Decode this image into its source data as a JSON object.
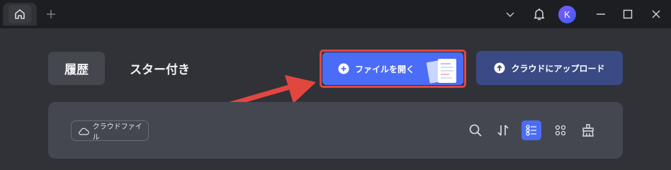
{
  "titlebar": {
    "icons": [
      "home-icon",
      "plus-icon",
      "chevron-down-icon",
      "bell-icon",
      "minimize-icon",
      "maximize-icon",
      "close-icon"
    ],
    "avatar_initial": "K"
  },
  "tabs": {
    "history_label": "履歴",
    "starred_label": "スター付き"
  },
  "actions": {
    "open_file_label": "ファイルを開く",
    "upload_cloud_label": "クラウドにアップロード"
  },
  "panel": {
    "cloud_file_label": "クラウドファイル",
    "tool_icons": [
      "search-icon",
      "sort-icon",
      "list-view-icon",
      "grid-view-icon",
      "clean-icon"
    ]
  },
  "colors": {
    "accent": "#4a6cf7",
    "highlight": "#e2473f",
    "upload": "#394a85"
  }
}
